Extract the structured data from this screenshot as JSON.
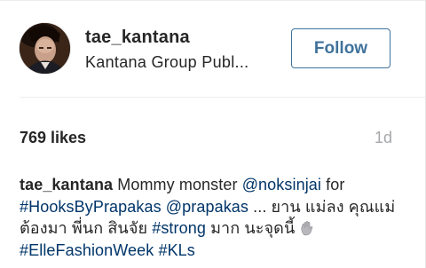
{
  "header": {
    "username": "tae_kantana",
    "subtitle": "Kantana Group Publ...",
    "follow_label": "Follow"
  },
  "post": {
    "likes": "769 likes",
    "time": "1d"
  },
  "caption": {
    "user": "tae_kantana",
    "t1": " Mommy monster ",
    "mention1": "@noksinjai",
    "t2": " for ",
    "tag1": "#HooksByPrapakas",
    "t3": " ",
    "mention2": "@prapakas",
    "t4": " ... ยาน แม่ลง คุณแม่ต้องมา พี่นก สินจัย ",
    "tag2": "#strong",
    "t5": " มาก นะจุดนี้ ",
    "t6": " ",
    "tag3": "#ElleFashionWeek",
    "t7": " ",
    "tag4": "#KLs"
  },
  "colors": {
    "text": "#262626",
    "link": "#003569",
    "follow": "#3f729b",
    "muted": "#a5a7aa"
  },
  "icons": {
    "avatar": "profile-photo",
    "emoji": "waving-hand-icon"
  }
}
